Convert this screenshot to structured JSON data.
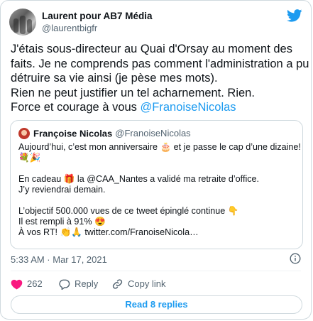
{
  "author": {
    "display_name": "Laurent pour AB7 Média",
    "handle": "@laurentbigfr"
  },
  "tweet": {
    "lines": [
      "J'étais sous-directeur au Quai d'Orsay au moment des",
      "faits. Je ne comprends pas comment l'administration a pu",
      "détruire sa vie ainsi (je pèse mes mots).",
      "Rien ne peut justifier un tel acharnement. Rien."
    ],
    "last_line_prefix": "Force et courage à vous ",
    "mention": "@FranoiseNicolas"
  },
  "quoted_tweet": {
    "display_name": "Françoise Nicolas",
    "handle": "@FranoiseNicolas",
    "line1": "Aujourd’hui, c’est mon anniversaire 🎂 et je passe le cap d’une dizaine!",
    "line2": "💐🎉",
    "line3": "En cadeau 🎁 la @CAA_Nantes a validé ma retraite d’office.",
    "line4": "J’y reviendrai demain.",
    "line5": "L’objectif 500.000 vues de ce tweet épinglé continue 👇",
    "line6": "Il est rempli à 91% 😍",
    "line7": "À vos RT! 👏🙏 twitter.com/FranoiseNicola…"
  },
  "timestamp": "5:33 AM · Mar 17, 2021",
  "actions": {
    "like_count": "262",
    "reply_label": "Reply",
    "copy_link_label": "Copy link"
  },
  "read_replies_label": "Read 8 replies",
  "colors": {
    "accent": "#1d9bf0",
    "like": "#f91880",
    "text": "#0f1419",
    "secondary": "#536471",
    "border": "#cfd9de"
  },
  "icons": [
    "twitter-bird-icon",
    "info-icon",
    "heart-icon",
    "reply-icon",
    "link-icon"
  ]
}
